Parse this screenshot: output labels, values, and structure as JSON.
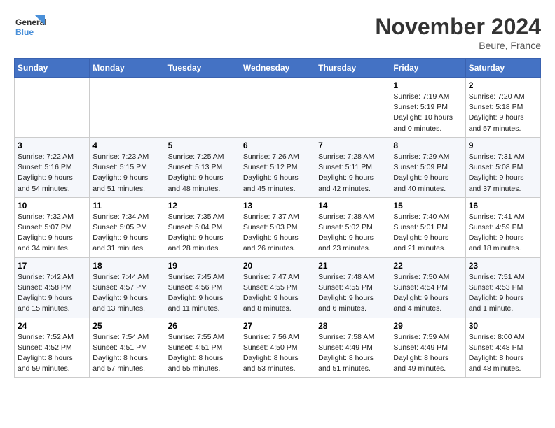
{
  "logo": {
    "line1": "General",
    "line2": "Blue"
  },
  "title": "November 2024",
  "location": "Beure, France",
  "weekdays": [
    "Sunday",
    "Monday",
    "Tuesday",
    "Wednesday",
    "Thursday",
    "Friday",
    "Saturday"
  ],
  "weeks": [
    [
      {
        "day": "",
        "info": ""
      },
      {
        "day": "",
        "info": ""
      },
      {
        "day": "",
        "info": ""
      },
      {
        "day": "",
        "info": ""
      },
      {
        "day": "",
        "info": ""
      },
      {
        "day": "1",
        "info": "Sunrise: 7:19 AM\nSunset: 5:19 PM\nDaylight: 10 hours and 0 minutes."
      },
      {
        "day": "2",
        "info": "Sunrise: 7:20 AM\nSunset: 5:18 PM\nDaylight: 9 hours and 57 minutes."
      }
    ],
    [
      {
        "day": "3",
        "info": "Sunrise: 7:22 AM\nSunset: 5:16 PM\nDaylight: 9 hours and 54 minutes."
      },
      {
        "day": "4",
        "info": "Sunrise: 7:23 AM\nSunset: 5:15 PM\nDaylight: 9 hours and 51 minutes."
      },
      {
        "day": "5",
        "info": "Sunrise: 7:25 AM\nSunset: 5:13 PM\nDaylight: 9 hours and 48 minutes."
      },
      {
        "day": "6",
        "info": "Sunrise: 7:26 AM\nSunset: 5:12 PM\nDaylight: 9 hours and 45 minutes."
      },
      {
        "day": "7",
        "info": "Sunrise: 7:28 AM\nSunset: 5:11 PM\nDaylight: 9 hours and 42 minutes."
      },
      {
        "day": "8",
        "info": "Sunrise: 7:29 AM\nSunset: 5:09 PM\nDaylight: 9 hours and 40 minutes."
      },
      {
        "day": "9",
        "info": "Sunrise: 7:31 AM\nSunset: 5:08 PM\nDaylight: 9 hours and 37 minutes."
      }
    ],
    [
      {
        "day": "10",
        "info": "Sunrise: 7:32 AM\nSunset: 5:07 PM\nDaylight: 9 hours and 34 minutes."
      },
      {
        "day": "11",
        "info": "Sunrise: 7:34 AM\nSunset: 5:05 PM\nDaylight: 9 hours and 31 minutes."
      },
      {
        "day": "12",
        "info": "Sunrise: 7:35 AM\nSunset: 5:04 PM\nDaylight: 9 hours and 28 minutes."
      },
      {
        "day": "13",
        "info": "Sunrise: 7:37 AM\nSunset: 5:03 PM\nDaylight: 9 hours and 26 minutes."
      },
      {
        "day": "14",
        "info": "Sunrise: 7:38 AM\nSunset: 5:02 PM\nDaylight: 9 hours and 23 minutes."
      },
      {
        "day": "15",
        "info": "Sunrise: 7:40 AM\nSunset: 5:01 PM\nDaylight: 9 hours and 21 minutes."
      },
      {
        "day": "16",
        "info": "Sunrise: 7:41 AM\nSunset: 4:59 PM\nDaylight: 9 hours and 18 minutes."
      }
    ],
    [
      {
        "day": "17",
        "info": "Sunrise: 7:42 AM\nSunset: 4:58 PM\nDaylight: 9 hours and 15 minutes."
      },
      {
        "day": "18",
        "info": "Sunrise: 7:44 AM\nSunset: 4:57 PM\nDaylight: 9 hours and 13 minutes."
      },
      {
        "day": "19",
        "info": "Sunrise: 7:45 AM\nSunset: 4:56 PM\nDaylight: 9 hours and 11 minutes."
      },
      {
        "day": "20",
        "info": "Sunrise: 7:47 AM\nSunset: 4:55 PM\nDaylight: 9 hours and 8 minutes."
      },
      {
        "day": "21",
        "info": "Sunrise: 7:48 AM\nSunset: 4:55 PM\nDaylight: 9 hours and 6 minutes."
      },
      {
        "day": "22",
        "info": "Sunrise: 7:50 AM\nSunset: 4:54 PM\nDaylight: 9 hours and 4 minutes."
      },
      {
        "day": "23",
        "info": "Sunrise: 7:51 AM\nSunset: 4:53 PM\nDaylight: 9 hours and 1 minute."
      }
    ],
    [
      {
        "day": "24",
        "info": "Sunrise: 7:52 AM\nSunset: 4:52 PM\nDaylight: 8 hours and 59 minutes."
      },
      {
        "day": "25",
        "info": "Sunrise: 7:54 AM\nSunset: 4:51 PM\nDaylight: 8 hours and 57 minutes."
      },
      {
        "day": "26",
        "info": "Sunrise: 7:55 AM\nSunset: 4:51 PM\nDaylight: 8 hours and 55 minutes."
      },
      {
        "day": "27",
        "info": "Sunrise: 7:56 AM\nSunset: 4:50 PM\nDaylight: 8 hours and 53 minutes."
      },
      {
        "day": "28",
        "info": "Sunrise: 7:58 AM\nSunset: 4:49 PM\nDaylight: 8 hours and 51 minutes."
      },
      {
        "day": "29",
        "info": "Sunrise: 7:59 AM\nSunset: 4:49 PM\nDaylight: 8 hours and 49 minutes."
      },
      {
        "day": "30",
        "info": "Sunrise: 8:00 AM\nSunset: 4:48 PM\nDaylight: 8 hours and 48 minutes."
      }
    ]
  ]
}
